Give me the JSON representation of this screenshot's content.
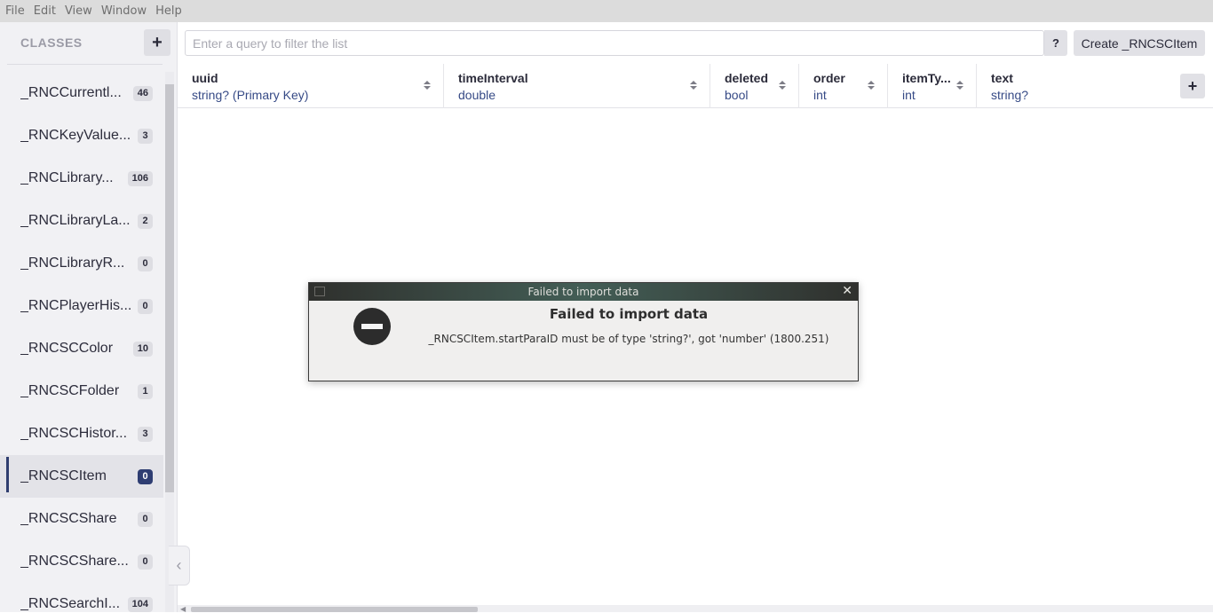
{
  "menu": [
    "File",
    "Edit",
    "View",
    "Window",
    "Help"
  ],
  "sidebar": {
    "title": "CLASSES",
    "add_label": "+",
    "collapse_label": "‹",
    "items": [
      {
        "name": "_RNCCurrentl...",
        "count": "46",
        "active": false
      },
      {
        "name": "_RNCKeyValue...",
        "count": "3",
        "active": false
      },
      {
        "name": "_RNCLibrary...",
        "count": "106",
        "active": false
      },
      {
        "name": "_RNCLibraryLa...",
        "count": "2",
        "active": false
      },
      {
        "name": "_RNCLibraryR...",
        "count": "0",
        "active": false
      },
      {
        "name": "_RNCPlayerHis...",
        "count": "0",
        "active": false
      },
      {
        "name": "_RNCSCColor",
        "count": "10",
        "active": false
      },
      {
        "name": "_RNCSCFolder",
        "count": "1",
        "active": false
      },
      {
        "name": "_RNCSCHistor...",
        "count": "3",
        "active": false
      },
      {
        "name": "_RNCSCItem",
        "count": "0",
        "active": true
      },
      {
        "name": "_RNCSCShare",
        "count": "0",
        "active": false
      },
      {
        "name": "_RNCSCShare...",
        "count": "0",
        "active": false
      },
      {
        "name": "_RNCSearchI...",
        "count": "104",
        "active": false
      }
    ]
  },
  "toolbar": {
    "search_placeholder": "Enter a query to filter the list",
    "search_value": "",
    "help_label": "?",
    "create_label": "Create _RNCSCItem"
  },
  "columns": [
    {
      "name": "uuid",
      "type": "string? (Primary Key)"
    },
    {
      "name": "timeInterval",
      "type": "double"
    },
    {
      "name": "deleted",
      "type": "bool"
    },
    {
      "name": "order",
      "type": "int"
    },
    {
      "name": "itemTy...",
      "type": "int"
    },
    {
      "name": "text",
      "type": "string?"
    }
  ],
  "add_column_label": "+",
  "dialog": {
    "window_title": "Failed to import data",
    "close_label": "✕",
    "heading": "Failed to import data",
    "message": "_RNCSCItem.startParaID must be of type 'string?', got 'number' (1800.251)"
  }
}
